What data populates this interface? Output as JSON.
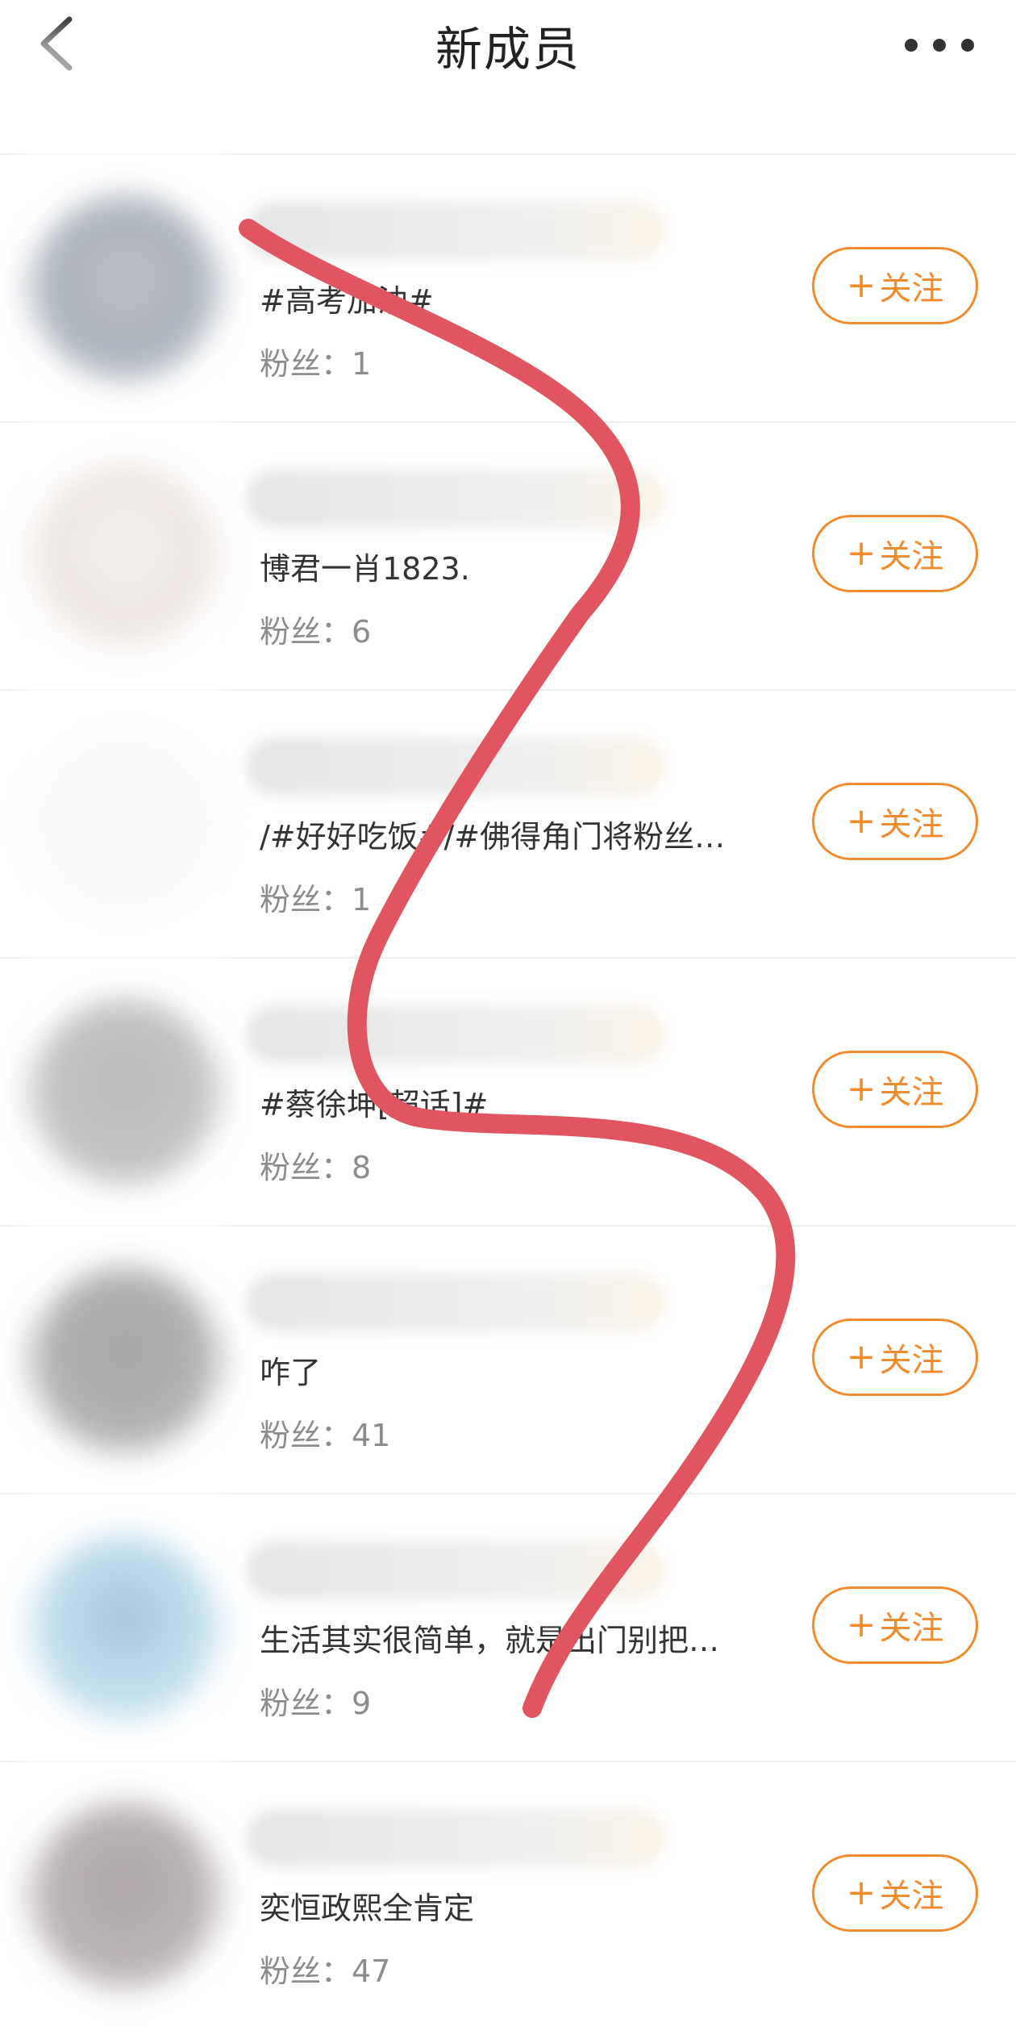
{
  "header": {
    "title": "新成员",
    "back_icon": "chevron-left-icon",
    "more_icon": "more-horizontal-icon"
  },
  "colors": {
    "accent": "#f08c2e",
    "scribble": "#e05560",
    "divider": "#ededed"
  },
  "follow_label": "关注",
  "members": [
    {
      "desc": "#高考加油#",
      "fans": "粉丝：1",
      "avatar_colors": [
        "#6a6e78",
        "#4a5a70",
        "#9aa0a8"
      ]
    },
    {
      "desc": "博君一肖1823.",
      "fans": "粉丝：6",
      "avatar_colors": [
        "#e8e0d8",
        "#d8c8c0",
        "#f0ece8"
      ]
    },
    {
      "desc": "/#好好吃饭#/#佛得角门将粉丝…",
      "fans": "粉丝：1",
      "avatar_colors": [
        "#f4f4f4",
        "#f0f0f0",
        "#f8f8f8"
      ]
    },
    {
      "desc": "#蔡徐坤[超话]#",
      "fans": "粉丝：8",
      "avatar_colors": [
        "#666666",
        "#7a7a7a",
        "#999999"
      ]
    },
    {
      "desc": "咋了",
      "fans": "粉丝：41",
      "avatar_colors": [
        "#3a3a3a",
        "#555555",
        "#888888"
      ]
    },
    {
      "desc": "生活其实很简单，就是出门别把…",
      "fans": "粉丝：9",
      "avatar_colors": [
        "#3e7bb8",
        "#7ab8d8",
        "#a8d4ea"
      ]
    },
    {
      "desc": "奕恒政熙全肯定",
      "fans": "粉丝：47",
      "avatar_colors": [
        "#4a3a3a",
        "#6a5a5a",
        "#8a7a7a"
      ]
    }
  ]
}
